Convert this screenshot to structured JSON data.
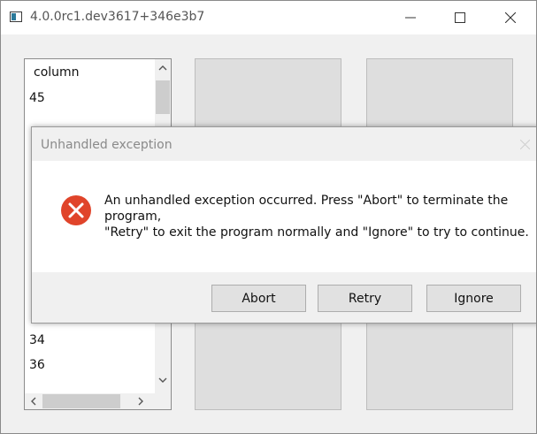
{
  "window": {
    "title": "4.0.0rc1.dev3617+346e3b7",
    "controls": {
      "minimize": "minimize",
      "maximize": "maximize",
      "close": "close"
    }
  },
  "list": {
    "header": "column",
    "top_rows": [
      "45"
    ],
    "bottom_rows": [
      "34",
      "36"
    ]
  },
  "dialog": {
    "title": "Unhandled exception",
    "icon": "error-icon",
    "message_lines": [
      "An unhandled exception occurred. Press \"Abort\" to terminate the",
      "program,",
      "\"Retry\" to exit the program normally and \"Ignore\" to try to continue."
    ],
    "buttons": {
      "abort": "Abort",
      "retry": "Retry",
      "ignore": "Ignore"
    }
  },
  "colors": {
    "error": "#e0442a",
    "window_bg": "#f0f0f0",
    "panel": "#dedede"
  }
}
